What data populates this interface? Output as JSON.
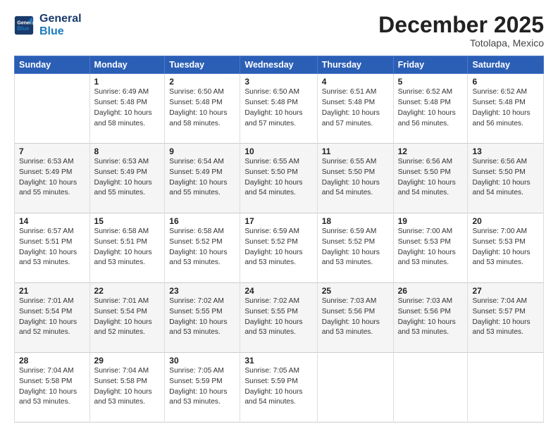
{
  "logo": {
    "line1": "General",
    "line2": "Blue"
  },
  "header": {
    "month": "December 2025",
    "location": "Totolapa, Mexico"
  },
  "weekdays": [
    "Sunday",
    "Monday",
    "Tuesday",
    "Wednesday",
    "Thursday",
    "Friday",
    "Saturday"
  ],
  "weeks": [
    [
      {
        "day": "",
        "text": ""
      },
      {
        "day": "1",
        "text": "Sunrise: 6:49 AM\nSunset: 5:48 PM\nDaylight: 10 hours\nand 58 minutes."
      },
      {
        "day": "2",
        "text": "Sunrise: 6:50 AM\nSunset: 5:48 PM\nDaylight: 10 hours\nand 58 minutes."
      },
      {
        "day": "3",
        "text": "Sunrise: 6:50 AM\nSunset: 5:48 PM\nDaylight: 10 hours\nand 57 minutes."
      },
      {
        "day": "4",
        "text": "Sunrise: 6:51 AM\nSunset: 5:48 PM\nDaylight: 10 hours\nand 57 minutes."
      },
      {
        "day": "5",
        "text": "Sunrise: 6:52 AM\nSunset: 5:48 PM\nDaylight: 10 hours\nand 56 minutes."
      },
      {
        "day": "6",
        "text": "Sunrise: 6:52 AM\nSunset: 5:48 PM\nDaylight: 10 hours\nand 56 minutes."
      }
    ],
    [
      {
        "day": "7",
        "text": "Sunrise: 6:53 AM\nSunset: 5:49 PM\nDaylight: 10 hours\nand 55 minutes."
      },
      {
        "day": "8",
        "text": "Sunrise: 6:53 AM\nSunset: 5:49 PM\nDaylight: 10 hours\nand 55 minutes."
      },
      {
        "day": "9",
        "text": "Sunrise: 6:54 AM\nSunset: 5:49 PM\nDaylight: 10 hours\nand 55 minutes."
      },
      {
        "day": "10",
        "text": "Sunrise: 6:55 AM\nSunset: 5:50 PM\nDaylight: 10 hours\nand 54 minutes."
      },
      {
        "day": "11",
        "text": "Sunrise: 6:55 AM\nSunset: 5:50 PM\nDaylight: 10 hours\nand 54 minutes."
      },
      {
        "day": "12",
        "text": "Sunrise: 6:56 AM\nSunset: 5:50 PM\nDaylight: 10 hours\nand 54 minutes."
      },
      {
        "day": "13",
        "text": "Sunrise: 6:56 AM\nSunset: 5:50 PM\nDaylight: 10 hours\nand 54 minutes."
      }
    ],
    [
      {
        "day": "14",
        "text": "Sunrise: 6:57 AM\nSunset: 5:51 PM\nDaylight: 10 hours\nand 53 minutes."
      },
      {
        "day": "15",
        "text": "Sunrise: 6:58 AM\nSunset: 5:51 PM\nDaylight: 10 hours\nand 53 minutes."
      },
      {
        "day": "16",
        "text": "Sunrise: 6:58 AM\nSunset: 5:52 PM\nDaylight: 10 hours\nand 53 minutes."
      },
      {
        "day": "17",
        "text": "Sunrise: 6:59 AM\nSunset: 5:52 PM\nDaylight: 10 hours\nand 53 minutes."
      },
      {
        "day": "18",
        "text": "Sunrise: 6:59 AM\nSunset: 5:52 PM\nDaylight: 10 hours\nand 53 minutes."
      },
      {
        "day": "19",
        "text": "Sunrise: 7:00 AM\nSunset: 5:53 PM\nDaylight: 10 hours\nand 53 minutes."
      },
      {
        "day": "20",
        "text": "Sunrise: 7:00 AM\nSunset: 5:53 PM\nDaylight: 10 hours\nand 53 minutes."
      }
    ],
    [
      {
        "day": "21",
        "text": "Sunrise: 7:01 AM\nSunset: 5:54 PM\nDaylight: 10 hours\nand 52 minutes."
      },
      {
        "day": "22",
        "text": "Sunrise: 7:01 AM\nSunset: 5:54 PM\nDaylight: 10 hours\nand 52 minutes."
      },
      {
        "day": "23",
        "text": "Sunrise: 7:02 AM\nSunset: 5:55 PM\nDaylight: 10 hours\nand 53 minutes."
      },
      {
        "day": "24",
        "text": "Sunrise: 7:02 AM\nSunset: 5:55 PM\nDaylight: 10 hours\nand 53 minutes."
      },
      {
        "day": "25",
        "text": "Sunrise: 7:03 AM\nSunset: 5:56 PM\nDaylight: 10 hours\nand 53 minutes."
      },
      {
        "day": "26",
        "text": "Sunrise: 7:03 AM\nSunset: 5:56 PM\nDaylight: 10 hours\nand 53 minutes."
      },
      {
        "day": "27",
        "text": "Sunrise: 7:04 AM\nSunset: 5:57 PM\nDaylight: 10 hours\nand 53 minutes."
      }
    ],
    [
      {
        "day": "28",
        "text": "Sunrise: 7:04 AM\nSunset: 5:58 PM\nDaylight: 10 hours\nand 53 minutes."
      },
      {
        "day": "29",
        "text": "Sunrise: 7:04 AM\nSunset: 5:58 PM\nDaylight: 10 hours\nand 53 minutes."
      },
      {
        "day": "30",
        "text": "Sunrise: 7:05 AM\nSunset: 5:59 PM\nDaylight: 10 hours\nand 53 minutes."
      },
      {
        "day": "31",
        "text": "Sunrise: 7:05 AM\nSunset: 5:59 PM\nDaylight: 10 hours\nand 54 minutes."
      },
      {
        "day": "",
        "text": ""
      },
      {
        "day": "",
        "text": ""
      },
      {
        "day": "",
        "text": ""
      }
    ]
  ]
}
